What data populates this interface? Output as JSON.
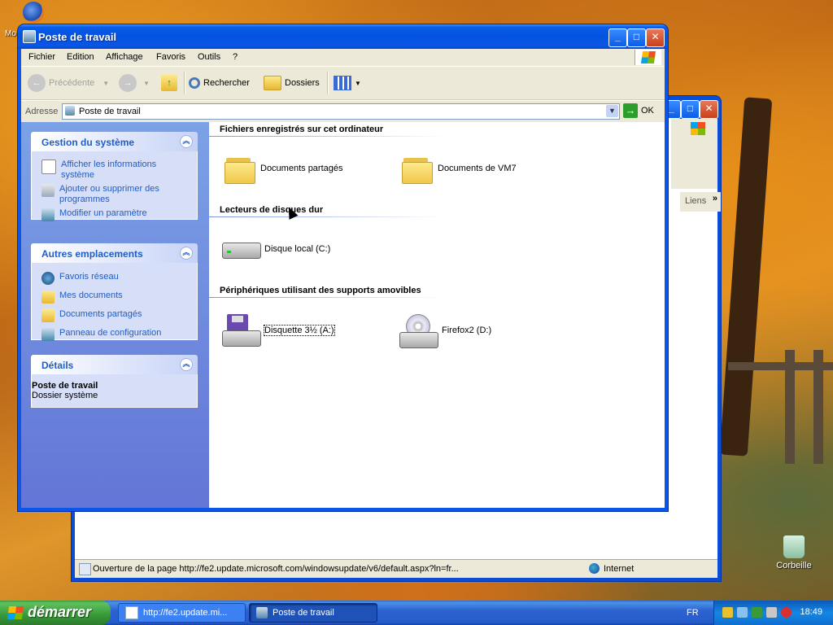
{
  "desktop": {
    "top_icon_label": "Mo",
    "recycle_label": "Corbeille"
  },
  "back_window": {
    "liens": "Liens",
    "status_text": "Ouverture de la page http://fe2.update.microsoft.com/windowsupdate/v6/default.aspx?ln=fr...",
    "zone": "Internet"
  },
  "window": {
    "title": "Poste de travail",
    "menu": [
      "Fichier",
      "Edition",
      "Affichage",
      "Favoris",
      "Outils",
      "?"
    ],
    "toolbar": {
      "back": "Précédente",
      "search": "Rechercher",
      "folders": "Dossiers"
    },
    "address": {
      "label": "Adresse",
      "value": "Poste de travail",
      "go": "OK"
    }
  },
  "taskpane": {
    "system": {
      "title": "Gestion du système",
      "links": [
        "Afficher les informations système",
        "Ajouter ou supprimer des programmes",
        "Modifier un paramètre"
      ]
    },
    "places": {
      "title": "Autres emplacements",
      "links": [
        "Favoris réseau",
        "Mes documents",
        "Documents partagés",
        "Panneau de configuration"
      ]
    },
    "details": {
      "title": "Détails",
      "name": "Poste de travail",
      "type": "Dossier système"
    }
  },
  "main": {
    "groups": [
      {
        "title": "Fichiers enregistrés sur cet ordinateur",
        "items": [
          "Documents partagés",
          "Documents de VM7"
        ]
      },
      {
        "title": "Lecteurs de disques dur",
        "items": [
          "Disque local (C:)"
        ]
      },
      {
        "title": "Périphériques utilisant des supports amovibles",
        "items": [
          "Disquette 3½ (A:)",
          "Firefox2 (D:)"
        ]
      }
    ]
  },
  "taskbar": {
    "start": "démarrer",
    "tasks": [
      "http://fe2.update.mi...",
      "Poste de travail"
    ],
    "lang": "FR",
    "clock": "18:49"
  },
  "colors": {
    "xp_blue": "#0a56e8",
    "link_blue": "#215dc6",
    "start_green": "#379837"
  }
}
